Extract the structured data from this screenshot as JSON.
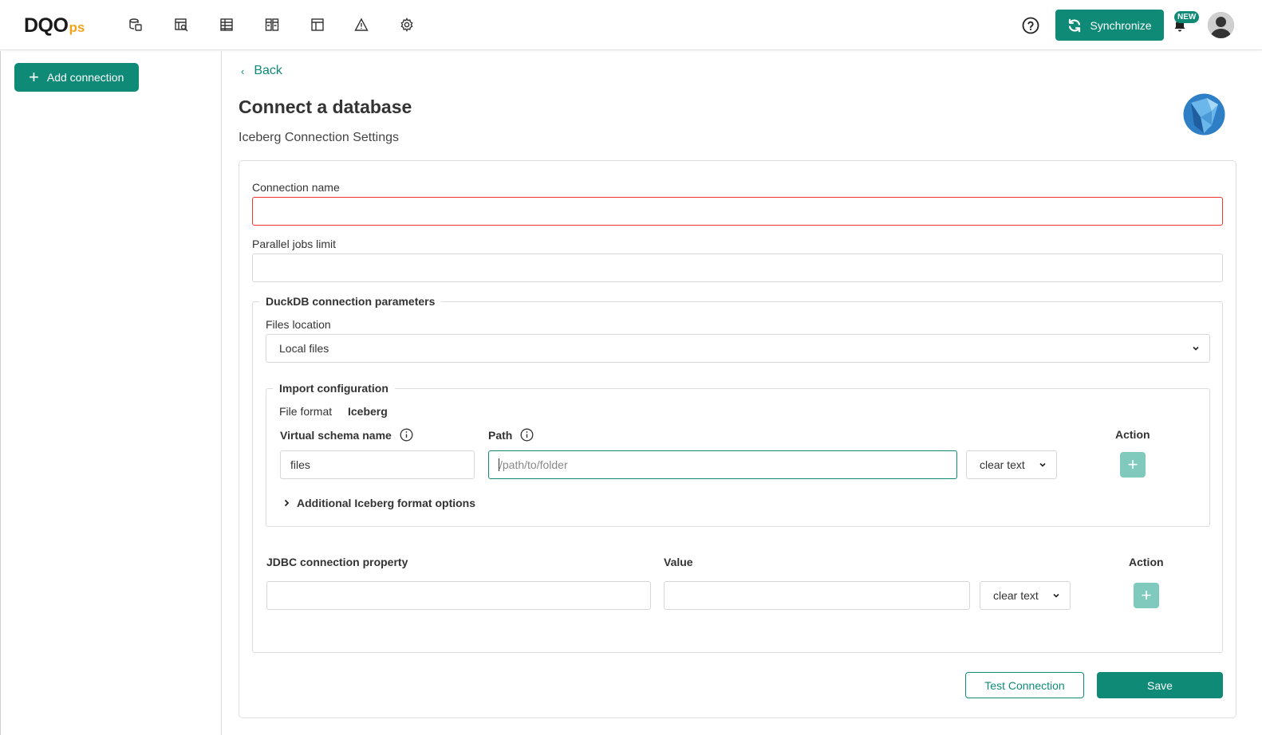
{
  "brand": {
    "logo_main": "DQO",
    "logo_suffix": "ps",
    "accent_color": "#0f8a77",
    "logo_accent": "#f3a31b"
  },
  "nav_icons": [
    "data-sources-icon",
    "data-profiling-icon",
    "data-quality-checks-icon",
    "data-quality-dashboards-icon",
    "data-quality-overview-icon",
    "incidents-icon",
    "configuration-icon"
  ],
  "header": {
    "help_icon": "help-circle-icon",
    "sync_label": "Synchronize",
    "notification_badge": "NEW"
  },
  "sidebar": {
    "add_connection_label": "Add connection"
  },
  "page": {
    "back_label": "Back",
    "title": "Connect a database",
    "subtitle": "Iceberg Connection Settings"
  },
  "form": {
    "connection_name_label": "Connection name",
    "connection_name_value": "",
    "parallel_jobs_label": "Parallel jobs limit",
    "parallel_jobs_value": "",
    "duckdb": {
      "legend": "DuckDB connection parameters",
      "files_location_label": "Files location",
      "files_location_value": "Local files"
    },
    "import": {
      "legend": "Import configuration",
      "file_format_label": "File format",
      "file_format_value": "Iceberg",
      "col_schema": "Virtual schema name",
      "col_path": "Path",
      "col_action": "Action",
      "schema_value": "files",
      "path_placeholder": "/path/to/folder",
      "path_mode": "clear text",
      "additional_options": "Additional Iceberg format options"
    },
    "jdbc": {
      "col_property": "JDBC connection property",
      "col_value": "Value",
      "col_action": "Action",
      "property_value": "",
      "value_value": "",
      "mode": "clear text"
    }
  },
  "actions": {
    "test_connection": "Test Connection",
    "save": "Save"
  }
}
